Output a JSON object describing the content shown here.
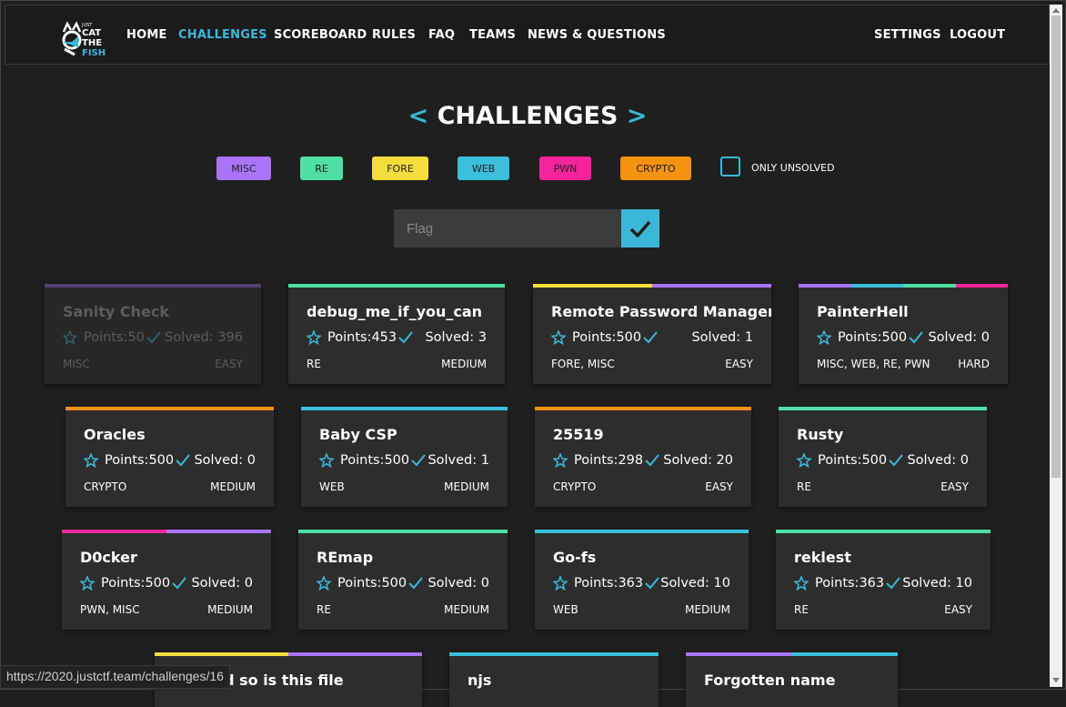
{
  "colors": {
    "misc": "#a974f8",
    "re": "#4fdea6",
    "fore": "#f4dd3c",
    "web": "#3bbfdd",
    "pwn": "#f5249b",
    "crypto": "#f5920f",
    "accent": "#3bb8d9"
  },
  "nav": {
    "logo_text": [
      "JUST",
      "CAT",
      "THE",
      "FISH"
    ],
    "items": [
      "HOME",
      "CHALLENGES",
      "SCOREBOARD",
      "RULES",
      "FAQ",
      "TEAMS",
      "NEWS & QUESTIONS"
    ],
    "right": [
      "SETTINGS",
      "LOGOUT"
    ]
  },
  "title": {
    "open": "<",
    "text": "CHALLENGES",
    "close": ">"
  },
  "filters": [
    "MISC",
    "RE",
    "FORE",
    "WEB",
    "PWN",
    "CRYPTO"
  ],
  "only_unsolved": "ONLY UNSOLVED",
  "flag": {
    "placeholder": "Flag"
  },
  "labels": {
    "points": "Points: ",
    "solved": "Solved: "
  },
  "challenges": [
    {
      "name": "Sanity Check",
      "points": 50,
      "solved": 396,
      "cats": "MISC",
      "diff": "EASY",
      "bars": [
        "misc"
      ],
      "is_solved": true
    },
    {
      "name": "debug_me_if_you_can",
      "points": 453,
      "solved": 3,
      "cats": "RE",
      "diff": "MEDIUM",
      "bars": [
        "re"
      ]
    },
    {
      "name": "Remote Password Manager",
      "points": 500,
      "solved": 1,
      "cats": "FORE, MISC",
      "diff": "EASY",
      "bars": [
        "fore",
        "misc"
      ]
    },
    {
      "name": "PainterHell",
      "points": 500,
      "solved": 0,
      "cats": "MISC, WEB, RE, PWN",
      "diff": "HARD",
      "bars": [
        "misc",
        "web",
        "re",
        "pwn"
      ]
    },
    {
      "name": "Oracles",
      "points": 500,
      "solved": 0,
      "cats": "CRYPTO",
      "diff": "MEDIUM",
      "bars": [
        "crypto"
      ]
    },
    {
      "name": "Baby CSP",
      "points": 500,
      "solved": 1,
      "cats": "WEB",
      "diff": "MEDIUM",
      "bars": [
        "web"
      ]
    },
    {
      "name": "25519",
      "points": 298,
      "solved": 20,
      "cats": "CRYPTO",
      "diff": "EASY",
      "bars": [
        "crypto"
      ]
    },
    {
      "name": "Rusty",
      "points": 500,
      "solved": 0,
      "cats": "RE",
      "diff": "EASY",
      "bars": [
        "re"
      ]
    },
    {
      "name": "D0cker",
      "points": 500,
      "solved": 0,
      "cats": "PWN, MISC",
      "diff": "MEDIUM",
      "bars": [
        "pwn",
        "misc"
      ]
    },
    {
      "name": "REmap",
      "points": 500,
      "solved": 0,
      "cats": "RE",
      "diff": "MEDIUM",
      "bars": [
        "re"
      ]
    },
    {
      "name": "Go-fs",
      "points": 363,
      "solved": 10,
      "cats": "WEB",
      "diff": "MEDIUM",
      "bars": [
        "web"
      ]
    },
    {
      "name": "reklest",
      "points": 363,
      "solved": 10,
      "cats": "RE",
      "diff": "EASY",
      "bars": [
        "re"
      ]
    },
    {
      "name": "en, and so is this file",
      "points": null,
      "solved": null,
      "cats": "",
      "diff": "",
      "bars": [
        "fore",
        "misc"
      ]
    },
    {
      "name": "njs",
      "points": null,
      "solved": null,
      "cats": "",
      "diff": "",
      "bars": [
        "web"
      ]
    },
    {
      "name": "Forgotten name",
      "points": null,
      "solved": null,
      "cats": "",
      "diff": "",
      "bars": [
        "misc",
        "web"
      ]
    }
  ],
  "status_url": "https://2020.justctf.team/challenges/16"
}
